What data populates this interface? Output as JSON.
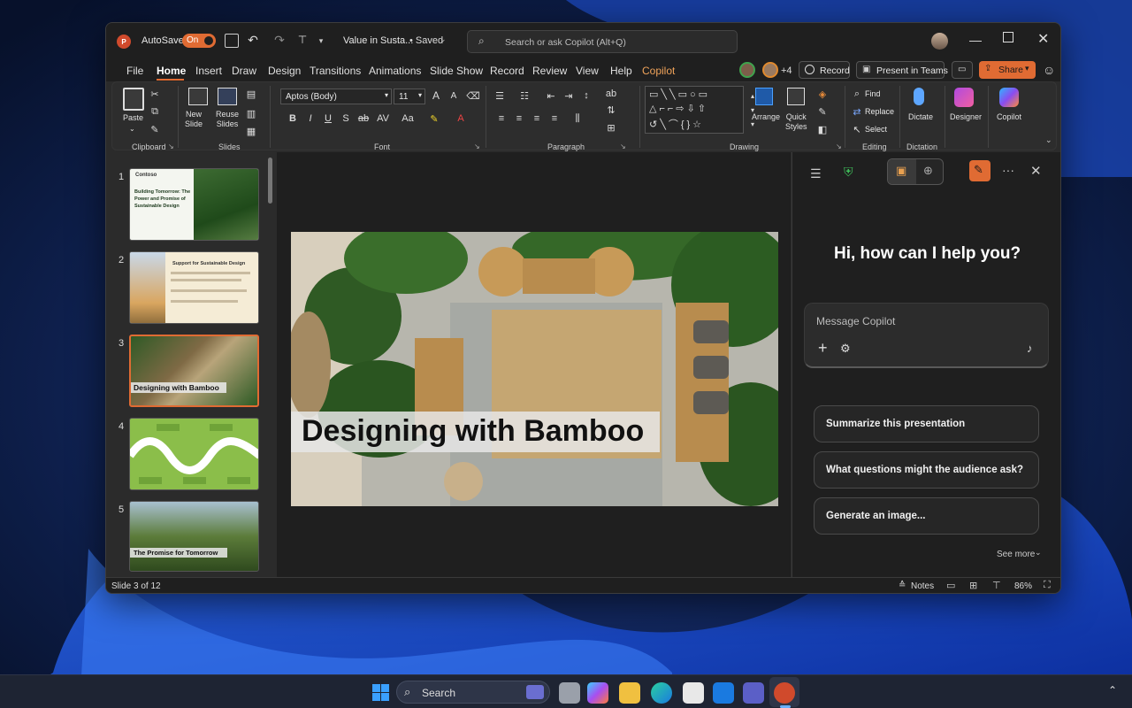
{
  "titlebar": {
    "autosave_label": "AutoSave",
    "autosave_state": "On",
    "doc_title": "Value in Susta...",
    "saved_status": "• Saved",
    "search_placeholder": "Search or ask Copilot (Alt+Q)"
  },
  "menu": {
    "items": [
      "File",
      "Home",
      "Insert",
      "Draw",
      "Design",
      "Transitions",
      "Animations",
      "Slide Show",
      "Record",
      "Review",
      "View",
      "Help",
      "Copilot"
    ],
    "active": "Home",
    "accent_item": "Copilot",
    "collab_count": "+4",
    "record_label": "Record",
    "present_teams_label": "Present in Teams",
    "share_label": "Share"
  },
  "ribbon": {
    "clipboard": {
      "group": "Clipboard",
      "paste": "Paste"
    },
    "slides": {
      "group": "Slides",
      "new_slide": "New\nSlide",
      "reuse_slides": "Reuse\nSlides"
    },
    "font": {
      "group": "Font",
      "font_name": "Aptos (Body)",
      "font_size": "11"
    },
    "paragraph": {
      "group": "Paragraph"
    },
    "drawing": {
      "group": "Drawing",
      "arrange": "Arrange",
      "quick_styles": "Quick\nStyles"
    },
    "editing": {
      "group": "Editing",
      "find": "Find",
      "replace": "Replace",
      "select": "Select"
    },
    "dictation": {
      "group": "Dictation",
      "dictate": "Dictate"
    },
    "designer": "Designer",
    "copilot": "Copilot"
  },
  "slides": [
    {
      "num": "1",
      "title": "Building Tomorrow: The Power and Promise of Sustainable Design",
      "brand": "Contoso"
    },
    {
      "num": "2",
      "title": "Support for Sustainable Design"
    },
    {
      "num": "3",
      "title": "Designing with Bamboo"
    },
    {
      "num": "4",
      "title": ""
    },
    {
      "num": "5",
      "title": "The Promise for Tomorrow"
    }
  ],
  "canvas": {
    "slide_title": "Designing with Bamboo"
  },
  "copilot": {
    "greeting": "Hi, how can I help you?",
    "input_placeholder": "Message Copilot",
    "suggestions": [
      "Summarize this presentation",
      "What questions might the audience ask?",
      "Generate an image..."
    ],
    "see_more": "See more"
  },
  "status": {
    "slide_counter": "Slide 3 of 12",
    "notes": "Notes",
    "zoom": "86%"
  },
  "taskbar": {
    "search_label": "Search"
  },
  "colors": {
    "accent": "#e06b33",
    "copilot_menu": "#f0a35a"
  }
}
